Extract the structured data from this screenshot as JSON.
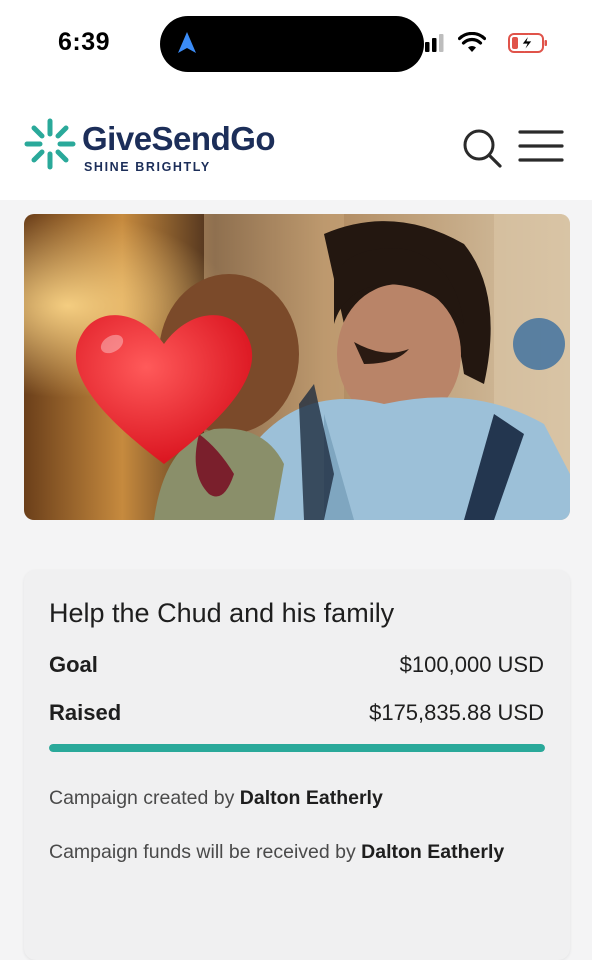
{
  "status_bar": {
    "time": "6:39"
  },
  "header": {
    "brand_name": "GiveSendGo",
    "tagline": "SHINE BRIGHTLY",
    "brand_color": "#1c2e59",
    "accent_color": "#2aa99a"
  },
  "campaign": {
    "title": "Help the Chud and his family",
    "goal_label": "Goal",
    "goal_value": "$100,000 USD",
    "raised_label": "Raised",
    "raised_value": "$175,835.88 USD",
    "progress_percent": 100,
    "created_by_text": "Campaign created by",
    "creator_name": "Dalton Eatherly",
    "funds_text": "Campaign funds will be received by",
    "recipient_name": "Dalton Eatherly"
  },
  "icons": {
    "search": "search-icon",
    "menu": "hamburger-menu-icon",
    "logo": "sun-burst-logo-icon",
    "privacy": "heart-emoji-icon"
  }
}
